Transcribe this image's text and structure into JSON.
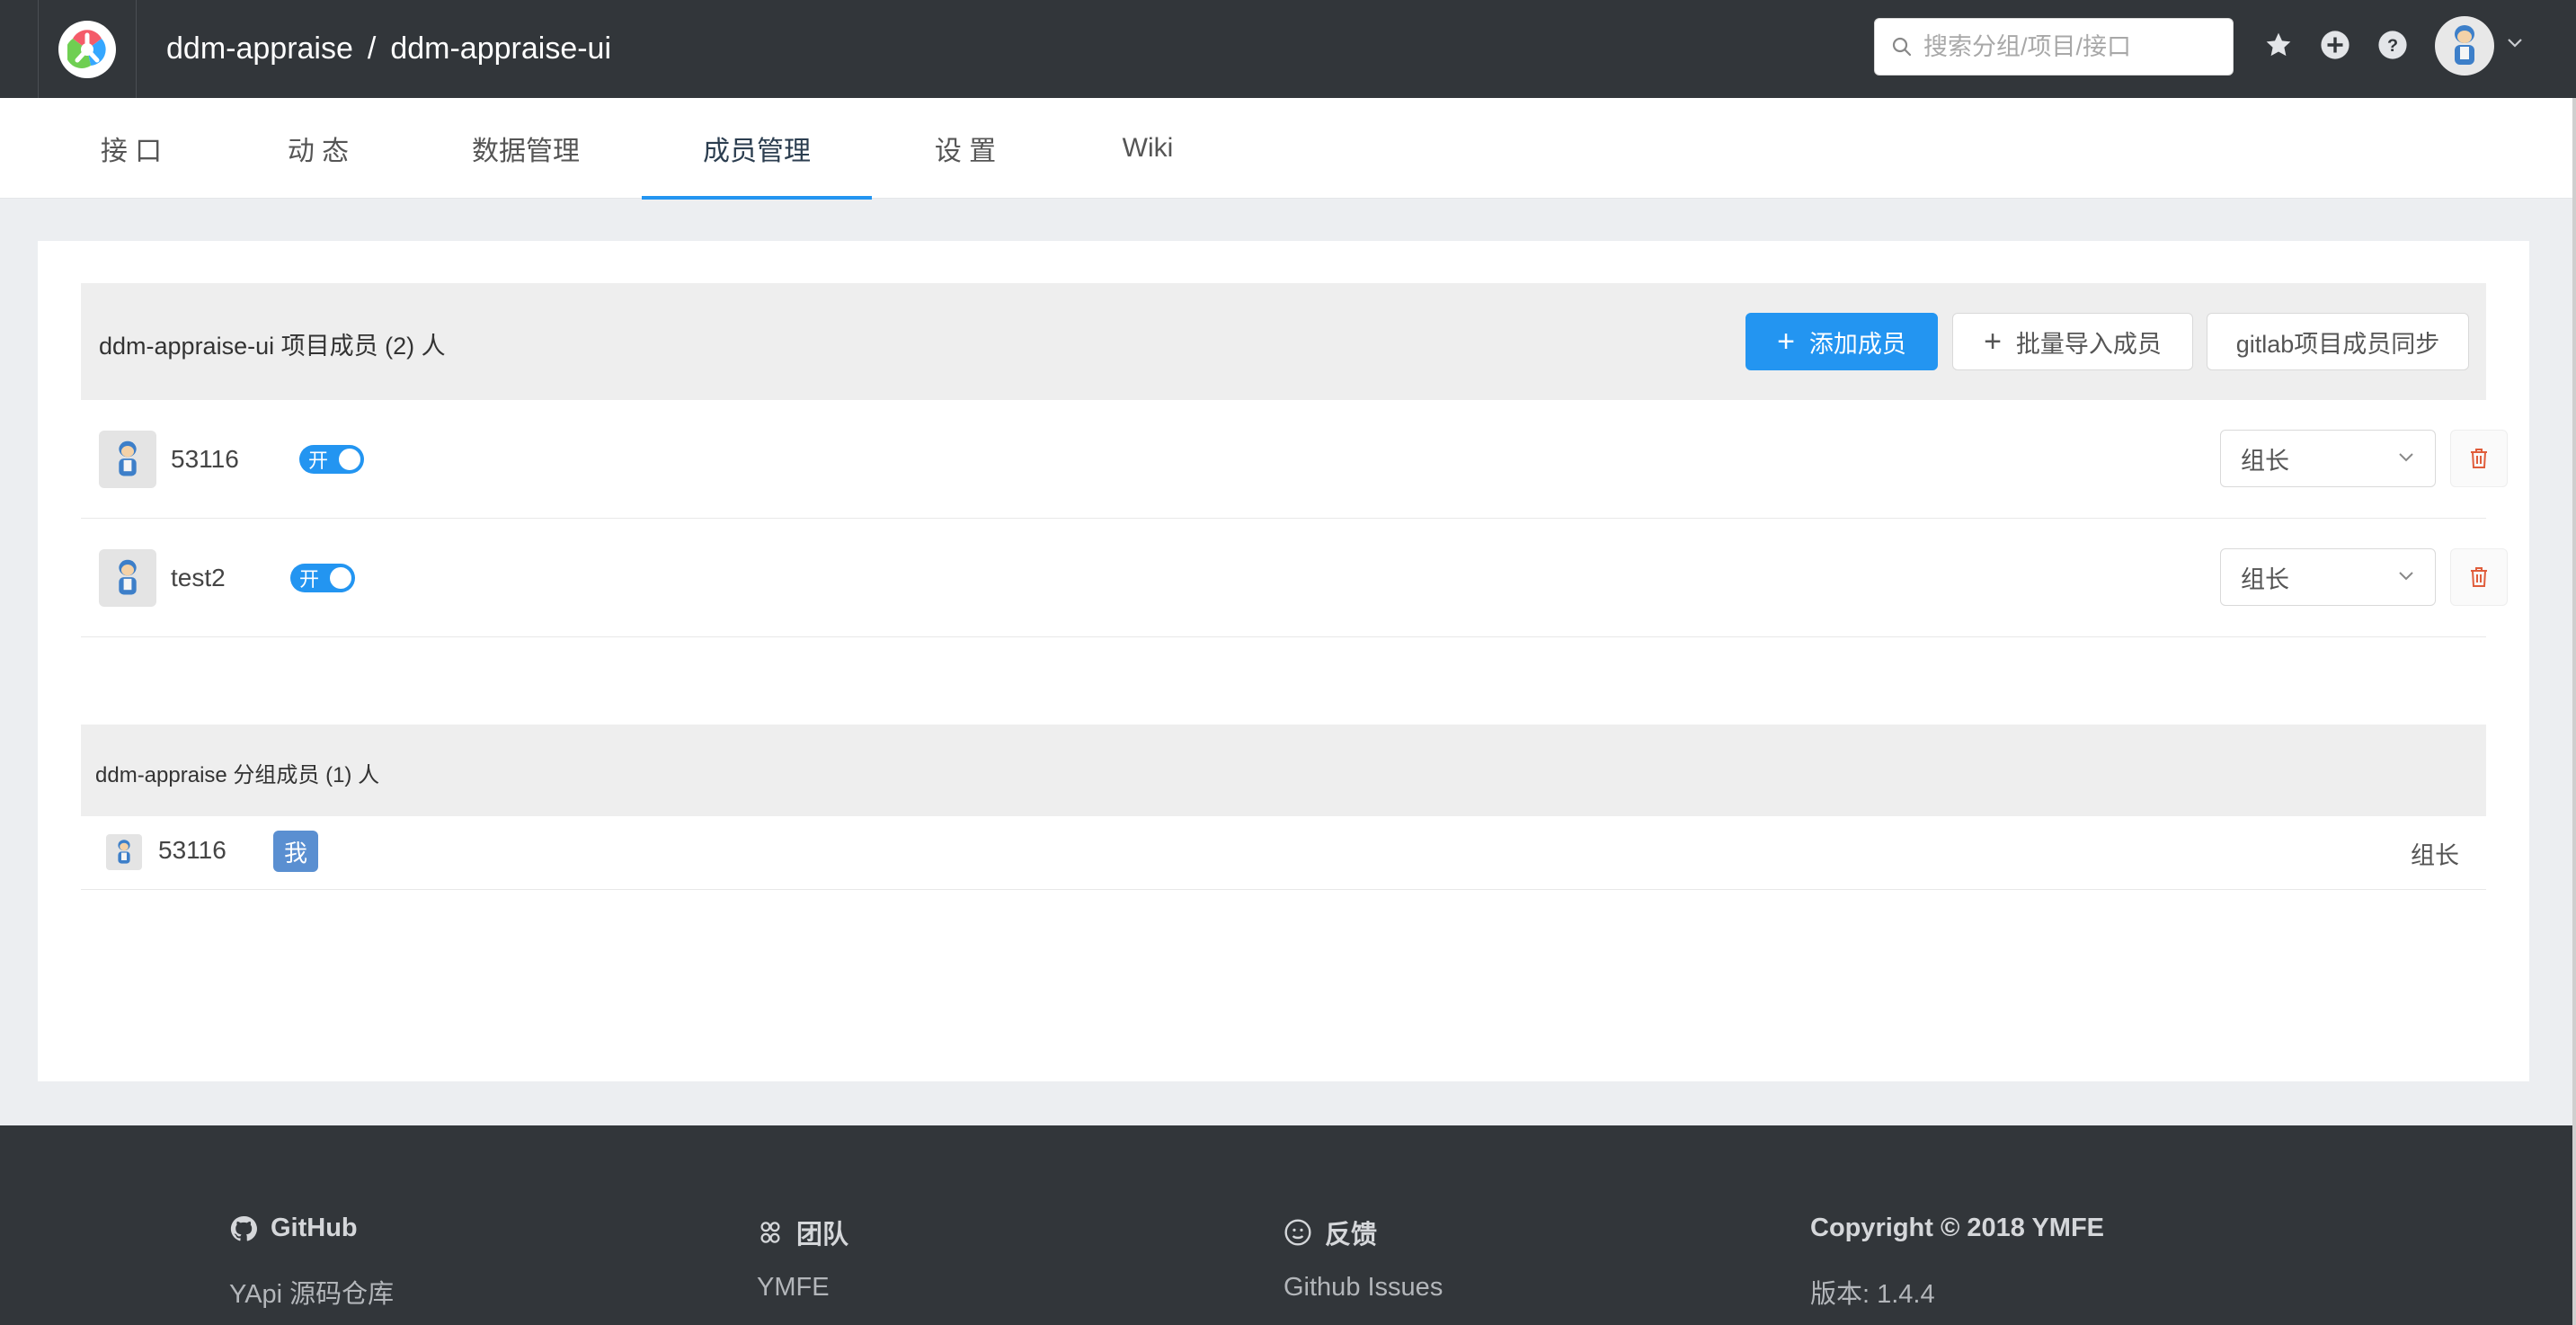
{
  "header": {
    "group": "ddm-appraise",
    "separator": "/",
    "project": "ddm-appraise-ui",
    "search_placeholder": "搜索分组/项目/接口",
    "icons": [
      "star-icon",
      "plus-circle-icon",
      "question-circle-icon",
      "avatar",
      "chevron-down-icon"
    ]
  },
  "tabs": [
    {
      "label": "接 口"
    },
    {
      "label": "动 态"
    },
    {
      "label": "数据管理"
    },
    {
      "label": "成员管理",
      "active": true
    },
    {
      "label": "设 置"
    },
    {
      "label": "Wiki"
    }
  ],
  "project_members": {
    "title": "ddm-appraise-ui 项目成员 (2) 人",
    "add_button": "添加成员",
    "import_button": "批量导入成员",
    "sync_button": "gitlab项目成员同步",
    "members": [
      {
        "name": "53116",
        "toggle": "开",
        "role": "组长"
      },
      {
        "name": "test2",
        "toggle": "开",
        "role": "组长"
      }
    ]
  },
  "group_members": {
    "title": "ddm-appraise 分组成员 (1) 人",
    "members": [
      {
        "name": "53116",
        "badge": "我",
        "role": "组长"
      }
    ]
  },
  "footer": {
    "columns": [
      {
        "heading": "GitHub",
        "icon": "github-icon",
        "link": "YApi 源码仓库"
      },
      {
        "heading": "团队",
        "icon": "team-icon",
        "link": "YMFE"
      },
      {
        "heading": "反馈",
        "icon": "smile-icon",
        "link": "Github Issues"
      },
      {
        "heading": "Copyright © 2018 YMFE",
        "icon": "",
        "link": "版本: 1.4.4"
      }
    ]
  },
  "colors": {
    "header_bg": "#32363a",
    "accent": "#2395f1",
    "delete": "#e05d3b",
    "me_badge": "#5a8fd1"
  }
}
